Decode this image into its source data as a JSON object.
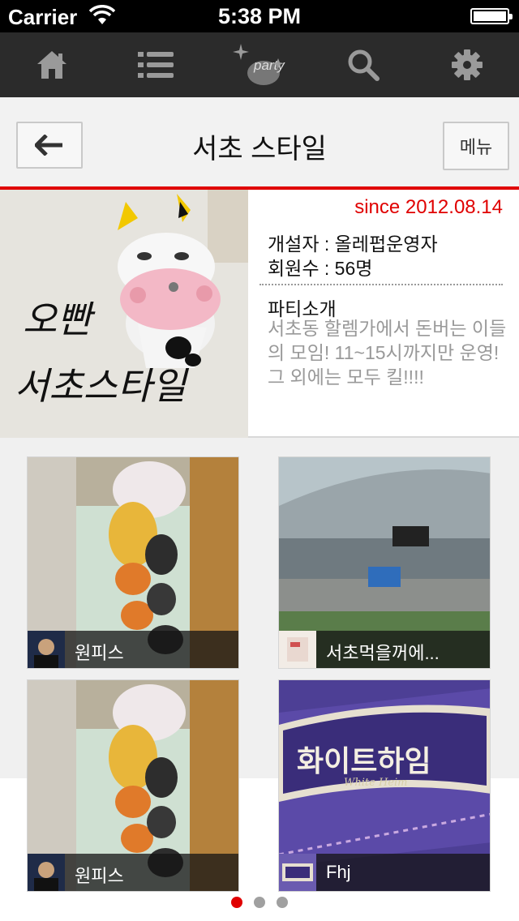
{
  "status_bar": {
    "carrier": "Carrier",
    "time": "5:38 PM"
  },
  "tabs": [
    {
      "icon": "home-icon"
    },
    {
      "icon": "list-icon"
    },
    {
      "icon": "party-logo-icon",
      "label": "party"
    },
    {
      "icon": "search-icon"
    },
    {
      "icon": "gear-icon"
    }
  ],
  "nav": {
    "title": "서초 스타일",
    "menu_label": "메뉴"
  },
  "party": {
    "since": "since 2012.08.14",
    "founder": "개설자 : 올레펍운영자",
    "members": "회원수 : 56명",
    "intro_title": "파티소개",
    "intro_text": "서초동 할렘가에서 돈버는 이들의 모임! 11~15시까지만 운영!그 외에는 모두 킬!!!!",
    "photo_text_line1": "오빤",
    "photo_text_line2": "서초스타일"
  },
  "posts": [
    {
      "title": "원피스"
    },
    {
      "title": "서초먹을꺼에..."
    },
    {
      "title": "원피스"
    },
    {
      "title": "Fhj"
    }
  ],
  "photo_text": {
    "white_heim": "화이트하임",
    "white_heim_sub": "White Heim"
  },
  "pager": {
    "pages": 3,
    "active": 0
  },
  "colors": {
    "accent": "#e00000",
    "tab_bar": "#2b2b2b"
  }
}
